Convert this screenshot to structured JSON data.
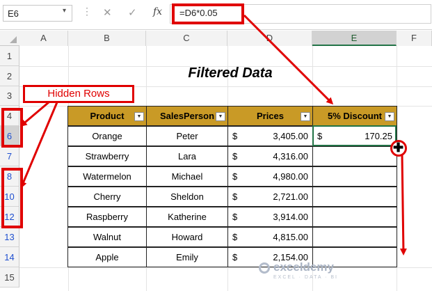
{
  "formula_bar": {
    "name_box": "E6",
    "cancel": "✕",
    "enter": "✓",
    "fx": "fx",
    "formula": "=D6*0.05"
  },
  "columns": [
    "A",
    "B",
    "C",
    "D",
    "E",
    "F"
  ],
  "rows": [
    "1",
    "2",
    "3",
    "4",
    "6",
    "7",
    "8",
    "10",
    "12",
    "13",
    "14",
    "15"
  ],
  "title": "Filtered Data",
  "table": {
    "headers": [
      "Product",
      "SalesPerson",
      "Prices",
      "5% Discount"
    ],
    "rows": [
      {
        "product": "Orange",
        "salesperson": "Peter",
        "currency": "$",
        "price": "3,405.00",
        "discount_currency": "$",
        "discount": "170.25"
      },
      {
        "product": "Strawberry",
        "salesperson": "Lara",
        "currency": "$",
        "price": "4,316.00",
        "discount_currency": "",
        "discount": ""
      },
      {
        "product": "Watermelon",
        "salesperson": "Michael",
        "currency": "$",
        "price": "4,980.00",
        "discount_currency": "",
        "discount": ""
      },
      {
        "product": "Cherry",
        "salesperson": "Sheldon",
        "currency": "$",
        "price": "2,721.00",
        "discount_currency": "",
        "discount": ""
      },
      {
        "product": "Raspberry",
        "salesperson": "Katherine",
        "currency": "$",
        "price": "3,914.00",
        "discount_currency": "",
        "discount": ""
      },
      {
        "product": "Walnut",
        "salesperson": "Howard",
        "currency": "$",
        "price": "4,815.00",
        "discount_currency": "",
        "discount": ""
      },
      {
        "product": "Apple",
        "salesperson": "Emily",
        "currency": "$",
        "price": "2,154.00",
        "discount_currency": "",
        "discount": ""
      }
    ]
  },
  "annotation": {
    "hidden_rows_label": "Hidden Rows",
    "accent": "#e00000"
  },
  "watermark": {
    "name": "exceldemy",
    "tagline": "EXCEL · DATA · BI"
  },
  "colors": {
    "header_fill": "#c99a26",
    "selection": "#217346",
    "hidden_row_number": "#1f4fcf"
  }
}
